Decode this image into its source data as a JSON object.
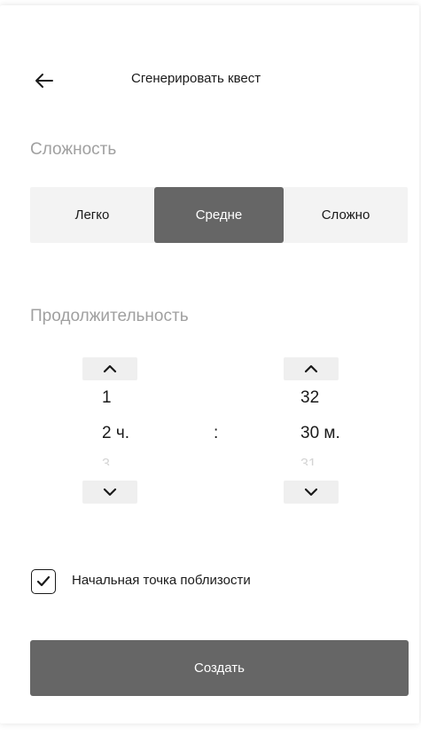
{
  "header": {
    "title": "Сгенерировать квест",
    "back_icon": "arrow-left-icon"
  },
  "difficulty": {
    "label": "Сложность",
    "options": [
      "Легко",
      "Средне",
      "Сложно"
    ],
    "selected": "Средне"
  },
  "duration": {
    "label": "Продолжительность",
    "hours": {
      "prev": "1",
      "current": "2 ч.",
      "next": "3"
    },
    "separator": ":",
    "minutes": {
      "prev": "32",
      "current": "30 м.",
      "next": "31"
    },
    "up_icon": "chevron-up-icon",
    "down_icon": "chevron-down-icon"
  },
  "nearby_start": {
    "label": "Начальная точка поблизости",
    "checked": true
  },
  "create_button": {
    "label": "Создать"
  },
  "colors": {
    "accent": "#666666",
    "segment_bg": "#f3f3f3",
    "muted_text": "#a0a0a0"
  }
}
